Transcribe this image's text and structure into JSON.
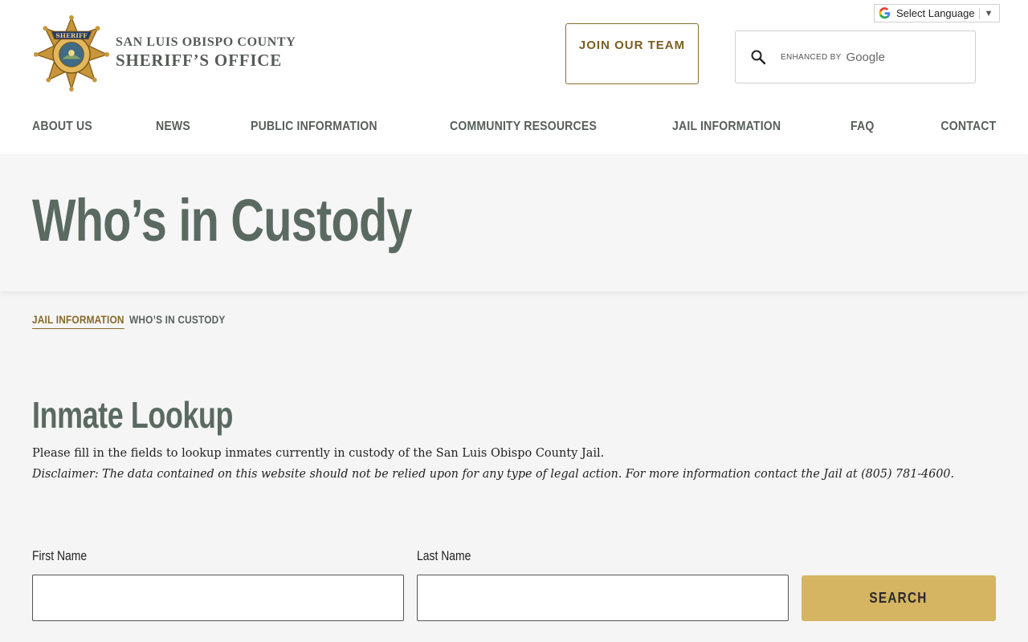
{
  "header": {
    "logo": {
      "badge_text": "SHERIFF",
      "line1": "SAN LUIS OBISPO COUNTY",
      "line2": "SHERIFF’S OFFICE"
    },
    "join_label": "JOIN OUR TEAM",
    "language": {
      "label": "Select Language",
      "arrow": "▼"
    },
    "search": {
      "enhanced_by": "ENHANCED BY",
      "provider": "Google"
    },
    "nav": [
      {
        "label": "ABOUT US"
      },
      {
        "label": "NEWS"
      },
      {
        "label": "PUBLIC INFORMATION"
      },
      {
        "label": "COMMUNITY RESOURCES"
      },
      {
        "label": "JAIL INFORMATION"
      },
      {
        "label": "FAQ"
      },
      {
        "label": "CONTACT"
      }
    ]
  },
  "hero": {
    "title": "Who’s in Custody"
  },
  "breadcrumb": {
    "parent": "JAIL INFORMATION",
    "current": "WHO’S IN CUSTODY"
  },
  "lookup": {
    "title": "Inmate Lookup",
    "intro": "Please fill in the fields to lookup inmates currently in custody of the San Luis Obispo County Jail.",
    "disclaimer": "Disclaimer: The data contained on this website should not be relied upon for any type of legal action. For more information contact the Jail at (805) 781-4600.",
    "first_name_label": "First Name",
    "first_name_value": "",
    "last_name_label": "Last Name",
    "last_name_value": "",
    "search_label": "SEARCH"
  },
  "colors": {
    "gold": "#d5b462",
    "brown_accent": "#86692b",
    "slate_green": "#5a6a61"
  }
}
